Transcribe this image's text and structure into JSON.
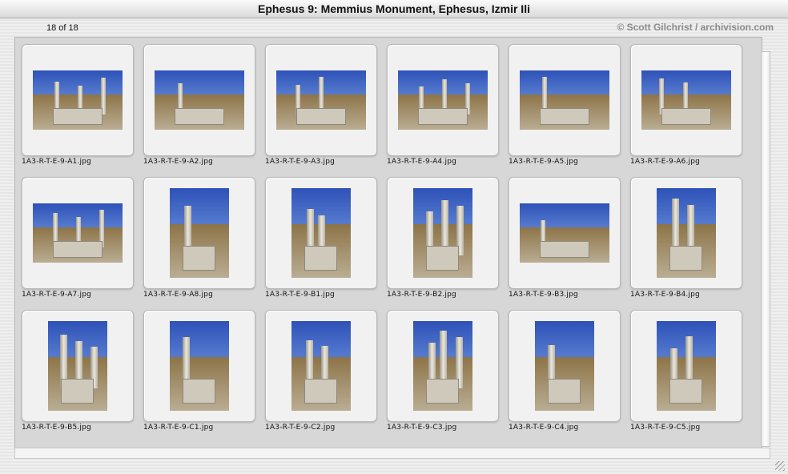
{
  "window": {
    "title": "Ephesus 9: Memmius Monument, Ephesus, Izmir Ili"
  },
  "header": {
    "count": "18 of 18",
    "copyright": "© Scott Gilchrist / archivision.com"
  },
  "colors": {
    "sky": "#2e52b8",
    "ground": "#8d7448",
    "stone": "#cfc9bb"
  },
  "slides": [
    {
      "filename": "1A3-R-T-E-9-A1.jpg",
      "orientation": "landscape"
    },
    {
      "filename": "1A3-R-T-E-9-A2.jpg",
      "orientation": "landscape"
    },
    {
      "filename": "1A3-R-T-E-9-A3.jpg",
      "orientation": "landscape"
    },
    {
      "filename": "1A3-R-T-E-9-A4.jpg",
      "orientation": "landscape"
    },
    {
      "filename": "1A3-R-T-E-9-A5.jpg",
      "orientation": "landscape"
    },
    {
      "filename": "1A3-R-T-E-9-A6.jpg",
      "orientation": "landscape"
    },
    {
      "filename": "1A3-R-T-E-9-A7.jpg",
      "orientation": "landscape"
    },
    {
      "filename": "1A3-R-T-E-9-A8.jpg",
      "orientation": "portrait"
    },
    {
      "filename": "1A3-R-T-E-9-B1.jpg",
      "orientation": "portrait"
    },
    {
      "filename": "1A3-R-T-E-9-B2.jpg",
      "orientation": "portrait"
    },
    {
      "filename": "1A3-R-T-E-9-B3.jpg",
      "orientation": "landscape"
    },
    {
      "filename": "1A3-R-T-E-9-B4.jpg",
      "orientation": "portrait"
    },
    {
      "filename": "1A3-R-T-E-9-B5.jpg",
      "orientation": "portrait"
    },
    {
      "filename": "1A3-R-T-E-9-C1.jpg",
      "orientation": "portrait"
    },
    {
      "filename": "1A3-R-T-E-9-C2.jpg",
      "orientation": "portrait"
    },
    {
      "filename": "1A3-R-T-E-9-C3.jpg",
      "orientation": "portrait"
    },
    {
      "filename": "1A3-R-T-E-9-C4.jpg",
      "orientation": "portrait"
    },
    {
      "filename": "1A3-R-T-E-9-C5.jpg",
      "orientation": "portrait"
    }
  ]
}
